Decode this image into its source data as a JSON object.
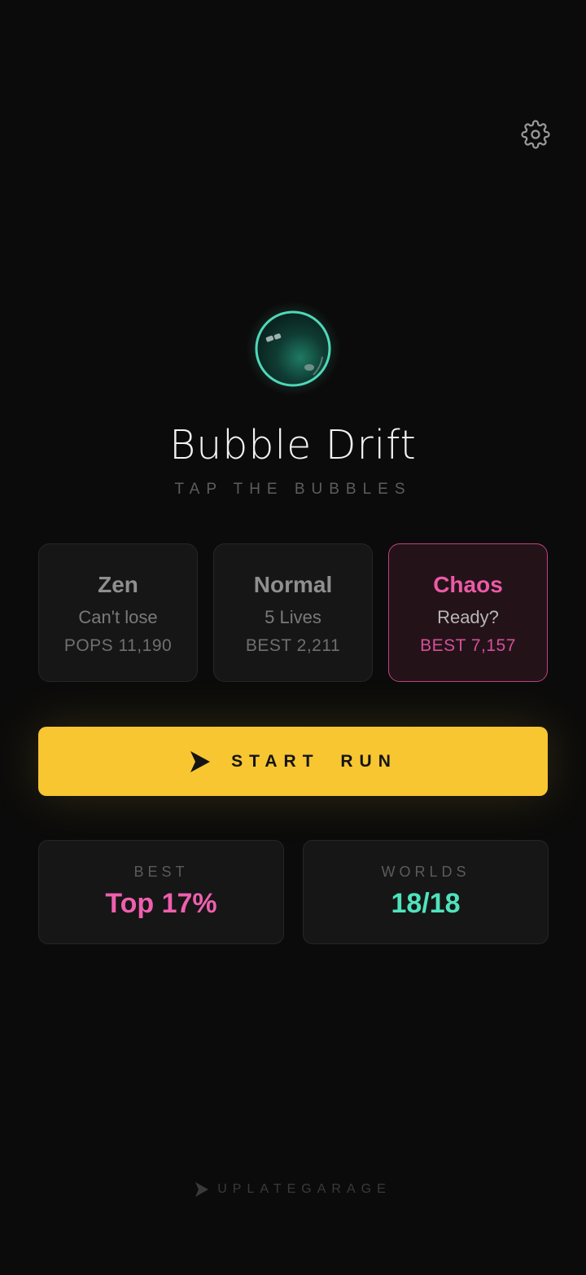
{
  "app": {
    "title": "Bubble Drift",
    "subtitle": "TAP THE BUBBLES"
  },
  "header": {
    "settings_icon": "gear-icon"
  },
  "logo": {
    "icon": "bubble-icon",
    "color": "#4fd8b8"
  },
  "modes": [
    {
      "name": "Zen",
      "desc": "Can't lose",
      "stat": "POPS 11,190",
      "selected": false
    },
    {
      "name": "Normal",
      "desc": "5 Lives",
      "stat": "BEST 2,211",
      "selected": false
    },
    {
      "name": "Chaos",
      "desc": "Ready?",
      "stat": "BEST 7,157",
      "selected": true
    }
  ],
  "start_button": {
    "label": "START RUN",
    "icon": "play-icon",
    "color": "#f7c631"
  },
  "stats": [
    {
      "label": "BEST",
      "value": "Top 17%",
      "color": "#ef5fae"
    },
    {
      "label": "WORLDS",
      "value": "18/18",
      "color": "#4fe3bd"
    }
  ],
  "footer": {
    "brand": "UPLATEGARAGE",
    "icon": "play-icon"
  }
}
